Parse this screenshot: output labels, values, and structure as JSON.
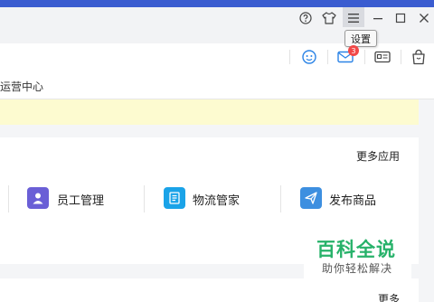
{
  "titlebar": {
    "icons": [
      "help-icon",
      "skin-icon",
      "menu-icon",
      "minimize-icon",
      "maximize-icon",
      "close-icon"
    ],
    "tooltip": "设置"
  },
  "toolbar": {
    "icons": [
      "customer-service-icon",
      "mail-icon",
      "card-icon",
      "bag-icon"
    ],
    "mail_badge": "3"
  },
  "nav": {
    "partial_label": "运营中心"
  },
  "apps": {
    "more_label": "更多应用",
    "items": [
      {
        "label": "员工管理",
        "icon": "employee-icon",
        "color": "#6a5fd6"
      },
      {
        "label": "物流管家",
        "icon": "logistics-icon",
        "color": "#1aa3e8"
      },
      {
        "label": "发布商品",
        "icon": "publish-icon",
        "color": "#3d8fe0"
      }
    ]
  },
  "section2": {
    "more_label": "更多"
  },
  "watermark": {
    "title": "百科全说",
    "subtitle": "助你轻松解决"
  },
  "colors": {
    "accent": "#3a5cd0",
    "badge": "#f24848",
    "notice_bg": "#fdfbd0",
    "watermark": "#27b26a"
  }
}
